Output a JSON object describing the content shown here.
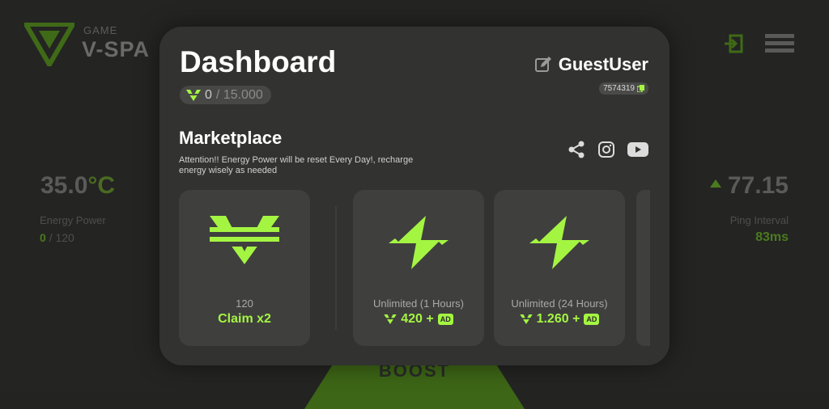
{
  "background": {
    "brand_small": "GAME",
    "brand_big": "V-SPA",
    "temperature": {
      "value": "35.0",
      "unit": "°C"
    },
    "energy": {
      "label": "Energy Power",
      "current": "0",
      "max": "/ 120"
    },
    "ping": {
      "value": "77.15",
      "label": "Ping Interval",
      "ms": "83ms"
    },
    "boost_label": "BOOST",
    "icons": [
      "logout-icon",
      "menu-icon"
    ]
  },
  "modal": {
    "title": "Dashboard",
    "balance": {
      "current": "0",
      "max": "/ 15.000",
      "icon": "v-coin-icon"
    },
    "user": {
      "name": "GuestUser",
      "id": "7574319",
      "edit_icon": "edit-icon",
      "copy_icon": "copy-icon"
    },
    "section_title": "Marketplace",
    "notice": "Attention!! Energy Power will be reset Every Day!, recharge energy wisely as needed",
    "socials": [
      "share-icon",
      "instagram-icon",
      "youtube-icon"
    ],
    "cards": [
      {
        "icon": "v-logo-icon",
        "sub": "120",
        "main": "Claim x2",
        "ad": ""
      },
      {
        "icon": "lightning-icon",
        "sub": "Unlimited (1 Hours)",
        "main": "420 +",
        "ad": "AD"
      },
      {
        "icon": "lightning-icon",
        "sub": "Unlimited (24 Hours)",
        "main": "1.260 +",
        "ad": "AD"
      }
    ]
  },
  "colors": {
    "accent": "#a4f542",
    "panel": "#323231",
    "card": "#3f3f3e",
    "bg": "#242423"
  }
}
